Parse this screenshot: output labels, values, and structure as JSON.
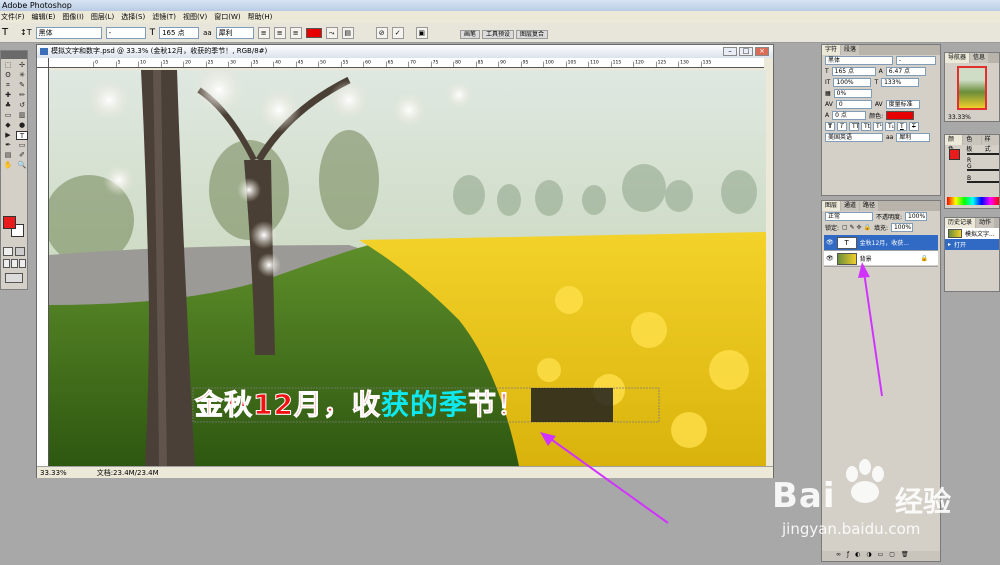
{
  "app": {
    "title": "Adobe Photoshop"
  },
  "menu": [
    "文件(F)",
    "编辑(E)",
    "图像(I)",
    "图层(L)",
    "选择(S)",
    "滤镜(T)",
    "视图(V)",
    "窗口(W)",
    "帮助(H)"
  ],
  "options": {
    "tool_glyph": "T",
    "font_family": "黑体",
    "font_style": "-",
    "font_size": "165 点",
    "antialias_label": "aa",
    "antialias": "犀利",
    "text_color": "#e60000",
    "wells": [
      "画笔",
      "工具预设",
      "图层复合"
    ]
  },
  "document": {
    "title": "模拟文字和数字.psd @ 33.3% (金秋12月，收获的季节！, RGB/8#)",
    "zoom": "33.33%",
    "doc_size": "文档:23.4M/23.4M",
    "ruler_ticks": [
      "0",
      "5",
      "10",
      "15",
      "20",
      "25",
      "30",
      "35",
      "40",
      "45",
      "50",
      "55",
      "60",
      "65",
      "70",
      "75",
      "80",
      "85",
      "90",
      "95",
      "100",
      "105",
      "110",
      "115",
      "120",
      "125",
      "130",
      "135"
    ],
    "canvas_text": [
      "金秋12月，收",
      "获的季",
      "节！"
    ]
  },
  "character_panel": {
    "tabs": [
      "字符",
      "段落"
    ],
    "font": "黑体",
    "style": "-",
    "size": "165 点",
    "leading": "6.47 点",
    "vscale": "100%",
    "hscale": "133%",
    "tracking_pct": "0%",
    "tracking": "0",
    "kerning": "度量标准",
    "baseline": "0 点",
    "color_label": "颜色:",
    "color": "#e60000",
    "language": "美国英语",
    "antialias": "犀利"
  },
  "layers_panel": {
    "tabs": [
      "图层",
      "通道",
      "路径"
    ],
    "blend": "正常",
    "opacity_label": "不透明度:",
    "opacity": "100%",
    "lock_label": "锁定:",
    "fill_label": "填充:",
    "fill": "100%",
    "layers": [
      {
        "name": "金秋12月，收获...",
        "type": "T",
        "selected": true
      },
      {
        "name": "背景",
        "type": "img",
        "selected": false
      }
    ]
  },
  "navigator": {
    "tabs": [
      "导航器",
      "信息"
    ],
    "zoom": "33.33%"
  },
  "color_panel": {
    "tabs": [
      "颜色",
      "色板",
      "样式"
    ],
    "channels": [
      "R",
      "G",
      "B"
    ]
  },
  "history_panel": {
    "tabs": [
      "历史记录",
      "动作"
    ],
    "snapshot": "模拟文字...",
    "item": "打开"
  },
  "watermark": {
    "brand": "Bai",
    "brand_cn": "经验",
    "url": "jingyan.baidu.com"
  }
}
